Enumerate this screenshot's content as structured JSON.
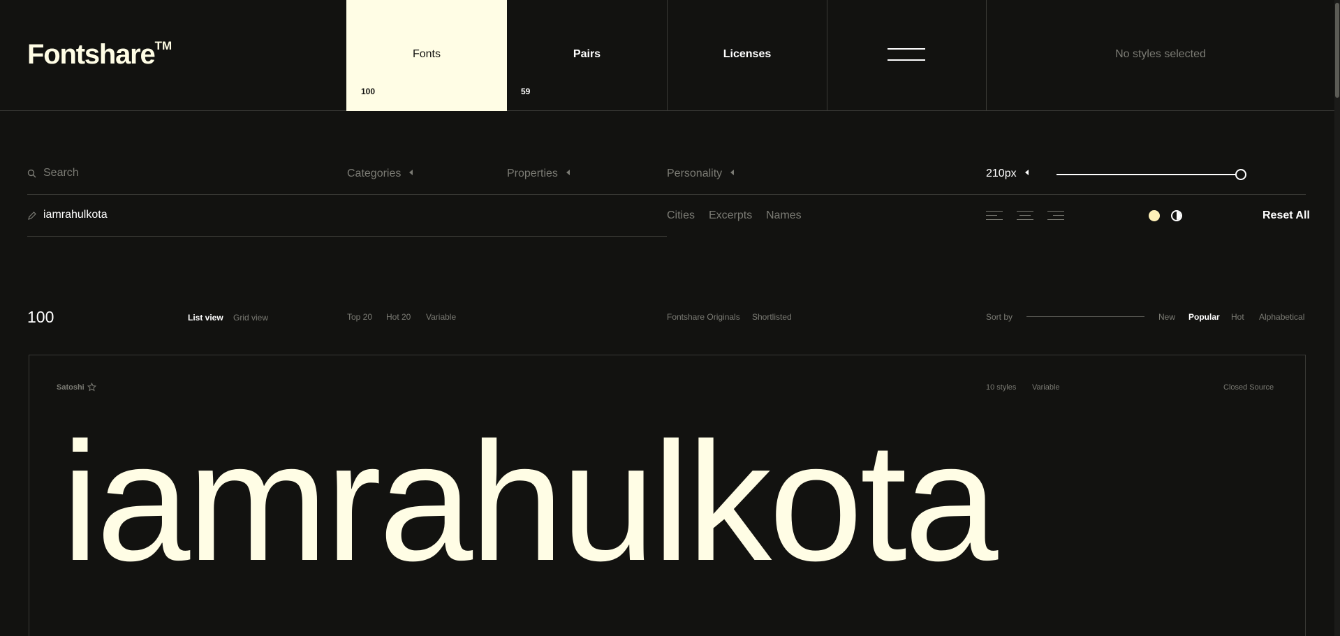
{
  "brand": {
    "logo": "Fontshare",
    "trademark": "TM"
  },
  "nav": {
    "fonts": {
      "label": "Fonts",
      "count": "100"
    },
    "pairs": {
      "label": "Pairs",
      "count": "59"
    },
    "licenses": {
      "label": "Licenses"
    },
    "selection_status": "No styles selected"
  },
  "filters": {
    "search_placeholder": "Search",
    "categories": "Categories",
    "properties": "Properties",
    "personality": "Personality",
    "size": "210px",
    "size_level_percent": 100,
    "preview_text": "iamrahulkota",
    "text_presets": [
      "Cities",
      "Excerpts",
      "Names"
    ],
    "reset": "Reset All"
  },
  "list_bar": {
    "count": "100",
    "views": [
      "List view",
      "Grid view"
    ],
    "active_view": "List view",
    "quick_filters": [
      "Top 20",
      "Hot 20",
      "Variable"
    ],
    "collections": [
      "Fontshare Originals",
      "Shortlisted"
    ],
    "sort_label": "Sort by",
    "sort_options": [
      "New",
      "Popular",
      "Hot",
      "Alphabetical"
    ],
    "active_sort": "Popular"
  },
  "font_card": {
    "name": "Satoshi",
    "styles": "10 styles",
    "variable": "Variable",
    "license": "Closed Source",
    "preview": "iamrahulkota"
  },
  "icons": [
    "search-icon",
    "pencil-icon",
    "caret-left-icon",
    "menu-icon",
    "align-left-icon",
    "align-center-icon",
    "align-right-icon",
    "light-theme-icon",
    "contrast-icon",
    "star-icon"
  ],
  "colors": {
    "background": "#121210",
    "accent": "#fffde5",
    "muted": "#7b7b74",
    "theme_dot": "#fff1b8"
  }
}
